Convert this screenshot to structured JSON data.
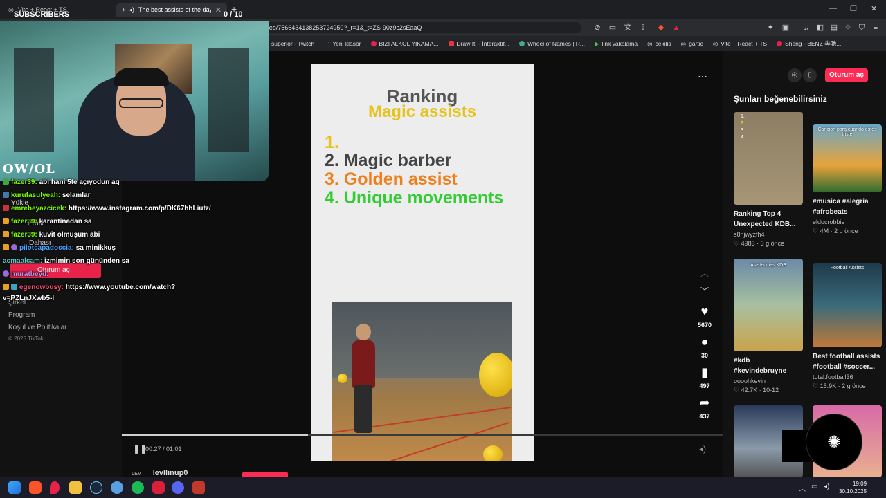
{
  "browser": {
    "tabs": [
      {
        "title": "Vite + React + TS"
      },
      {
        "title": "The best assists of the day #v..."
      }
    ],
    "url": "The best assists of the day #virale ...m/@levllinup0/video/7566434138253724950?_r=1&_t=ZS-90z9c2sEaaQ",
    "bookmarks": [
      "superior - Twitch",
      "Yeni klasör",
      "BIZI ALKOL YIKAMA...",
      "Draw It! - İnteraktif...",
      "Wheel of Names | R...",
      "link yakalama",
      "cekilis",
      "gartic",
      "Vite + React + TS",
      "Sheng - BENZ 奔驰..."
    ]
  },
  "stream": {
    "subscribers_label": "SUBSCRIBERS",
    "counter": "0 / 10",
    "logo_text": "OW/OL",
    "chat": [
      {
        "user": "fazer39:",
        "text": "abi hani 5te açıyodun aq",
        "color": "#7cfc00"
      },
      {
        "user": "kurufasulyeah:",
        "text": "selamlar",
        "color": "#7cfc00"
      },
      {
        "user": "emrebeyazcicek:",
        "text": "https://www.instagram.com/p/DK67hhLiutz/",
        "color": "#7cfc00"
      },
      {
        "user": "fazer39:",
        "text": "karantinadan sa",
        "color": "#7cfc00"
      },
      {
        "user": "fazer39:",
        "text": "kuvit olmuşum abi",
        "color": "#7cfc00"
      },
      {
        "user": "pilotcapadoccia:",
        "text": "sa minikkuş",
        "color": "#4aa3ff"
      },
      {
        "user": "acmaalcam:",
        "text": "izmimin son gününden sa",
        "color": "#4fd1c5"
      },
      {
        "user": "muratbeyd:",
        "text": "",
        "color": "#c792ea"
      },
      {
        "user": "egenowbusy:",
        "text": "https://www.youtube.com/watch?",
        "color": "#ff4d6d"
      },
      {
        "user": "",
        "text": "v=PZLnJXwb5-I",
        "color": "#ffffff"
      }
    ]
  },
  "leftnav": {
    "upload": "Yükle",
    "profile": "Profil",
    "more": "Dahası",
    "login": "Oturum aç",
    "company": "Şirket",
    "program": "Program",
    "terms": "Koşul ve Politikalar",
    "copyright": "© 2025 TikTok"
  },
  "video": {
    "title_line1": "Ranking",
    "title_line2": "Magic assists",
    "ranks": [
      {
        "num": "1.",
        "text": "",
        "color": "#e6c31c"
      },
      {
        "num": "2.",
        "text": "Magic barber",
        "color": "#444444"
      },
      {
        "num": "3.",
        "text": "Golden assist",
        "color": "#f07f1b"
      },
      {
        "num": "4.",
        "text": "Unique movements",
        "color": "#33cc33"
      }
    ],
    "time": "00:27 / 01:01",
    "progress_fraction": 0.31,
    "author": "levllinup0",
    "author_prefix": "LEV"
  },
  "actions": {
    "likes": "5670",
    "comments": "30",
    "saves": "497",
    "shares": "437"
  },
  "right": {
    "login_label": "Oturum aç",
    "heading": "Şunları beğenebilirsiniz",
    "cards": [
      {
        "title": "Ranking Top 4",
        "title2": "Unexpected KDB...",
        "author": "s8njwyzfh4",
        "stats": "♡ 4983 · 3 g önce"
      },
      {
        "title": "#musica #alegria",
        "title2": "#afrobeats",
        "author": "eldocrobbie",
        "stats": "♡ 4M · 2 g önce",
        "overlay": "Cancion para cuando estés triste"
      },
      {
        "title": "#kdb",
        "title2": "#kevindebruyne",
        "author": "oooohkevin",
        "stats": "♡ 42.7K · 10-12",
        "overlay": "Asistencias KDB"
      },
      {
        "title": "Best football assists",
        "title2": "#football #soccer...",
        "author": "total.football36",
        "stats": "♡ 15.9K · 2 g önce",
        "overlay": "Football Assists"
      }
    ]
  },
  "taskbar": {
    "time": "19:09",
    "date": "30.10.2025"
  }
}
